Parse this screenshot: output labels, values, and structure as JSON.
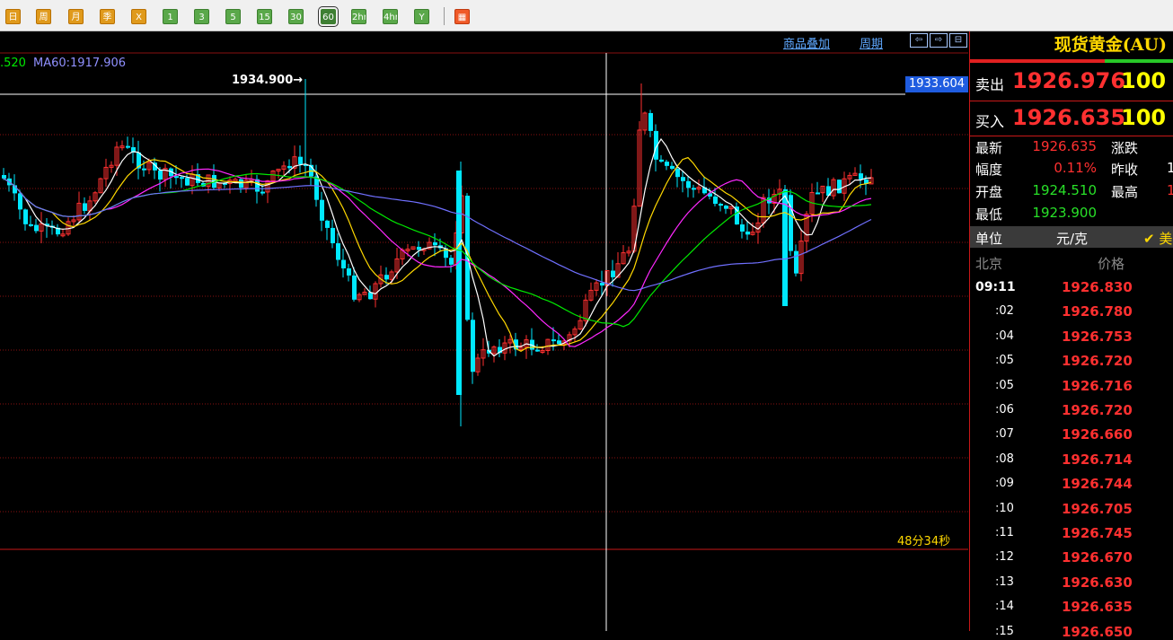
{
  "toolbar": {
    "buttons": [
      {
        "label": "日",
        "color": "orange"
      },
      {
        "label": "周",
        "color": "orange"
      },
      {
        "label": "月",
        "color": "orange"
      },
      {
        "label": "季",
        "color": "orange"
      },
      {
        "label": "X",
        "color": "orange"
      },
      {
        "label": "1",
        "color": "green"
      },
      {
        "label": "3",
        "color": "green"
      },
      {
        "label": "5",
        "color": "green"
      },
      {
        "label": "15",
        "color": "green"
      },
      {
        "label": "30",
        "color": "green"
      },
      {
        "label": "60",
        "color": "green",
        "active": true
      },
      {
        "label": "2hr",
        "color": "green"
      },
      {
        "label": "4hr",
        "color": "green"
      },
      {
        "label": "Y",
        "color": "green"
      },
      {
        "label": "▦",
        "color": "red"
      }
    ]
  },
  "chart": {
    "ma_label_partial": ".520",
    "ma60_label": "MA60:1917.906",
    "link_overlay": "商品叠加",
    "link_period": "周期",
    "arrows": [
      "⇦",
      "⇨",
      "⊟"
    ],
    "high_marker": "1934.900→",
    "cursor_price": "1933.604",
    "countdown": "48分34秒",
    "colors": {
      "up": "#ff3030",
      "down": "#00e8ff",
      "grid": "#8a1010",
      "ma5": "#ffffff",
      "ma10": "#ffd800",
      "ma20": "#ff28ff",
      "ma30": "#00e800",
      "ma60": "#7070ff"
    }
  },
  "panel": {
    "title": "现货黄金(AU)",
    "sell_label": "卖出",
    "sell_price": "1926.976",
    "sell_vol": "100",
    "buy_label": "买入",
    "buy_price": "1926.635",
    "buy_vol": "100",
    "stats": {
      "latest_label": "最新",
      "latest": "1926.635",
      "change_label": "涨跌",
      "amp_label": "幅度",
      "amp": "0.11%",
      "prev_label": "昨收",
      "prev_partial": "1",
      "open_label": "开盘",
      "open": "1924.510",
      "high_label": "最高",
      "high_partial": "1",
      "low_label": "最低",
      "low": "1923.900"
    },
    "unit_label": "单位",
    "unit_value": "元/克",
    "unit_check": "✔ 美",
    "tick_hdr_time": "北京",
    "tick_hdr_price": "价格",
    "ticks": [
      {
        "time": "09:11",
        "price": "1926.830"
      },
      {
        "time": ":02",
        "price": "1926.780"
      },
      {
        "time": ":04",
        "price": "1926.753"
      },
      {
        "time": ":05",
        "price": "1926.720"
      },
      {
        "time": ":05",
        "price": "1926.716"
      },
      {
        "time": ":06",
        "price": "1926.720"
      },
      {
        "time": ":07",
        "price": "1926.660"
      },
      {
        "time": ":08",
        "price": "1926.714"
      },
      {
        "time": ":09",
        "price": "1926.744"
      },
      {
        "time": ":10",
        "price": "1926.705"
      },
      {
        "time": ":11",
        "price": "1926.745"
      },
      {
        "time": ":12",
        "price": "1926.670"
      },
      {
        "time": ":13",
        "price": "1926.630"
      },
      {
        "time": ":14",
        "price": "1926.635"
      },
      {
        "time": ":15",
        "price": "1926.650"
      }
    ]
  }
}
